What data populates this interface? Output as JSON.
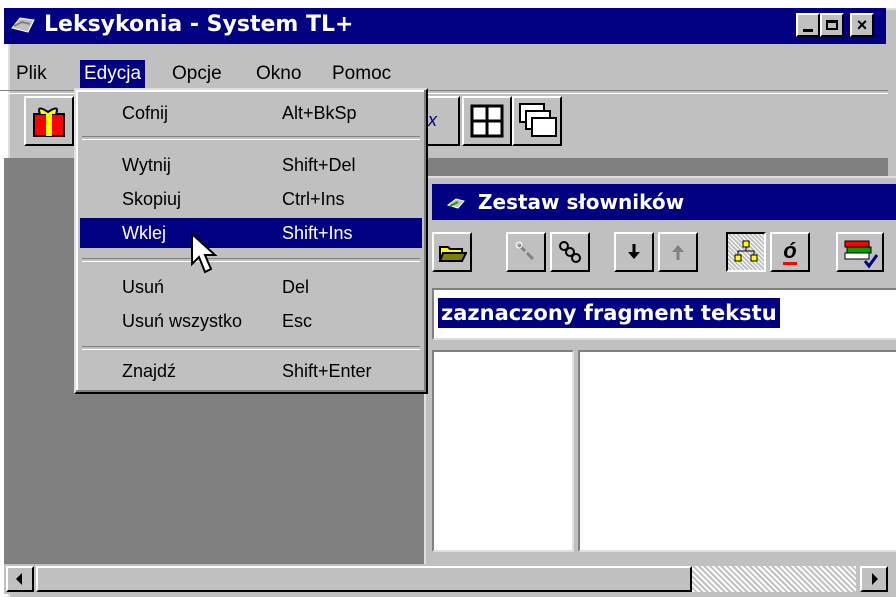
{
  "window": {
    "title": "Leksykonia - System TL+",
    "controls": {
      "minimize": "_",
      "maximize": "□",
      "close": "×"
    }
  },
  "menubar": [
    {
      "id": "plik",
      "label": "Plik"
    },
    {
      "id": "edycja",
      "label": "Edycja"
    },
    {
      "id": "opcje",
      "label": "Opcje"
    },
    {
      "id": "okno",
      "label": "Okno"
    },
    {
      "id": "pomoc",
      "label": "Pomoc"
    }
  ],
  "edit_menu": {
    "items": [
      {
        "label": "Cofnij",
        "shortcut": "Alt+BkSp"
      },
      {
        "label": "Wytnij",
        "shortcut": "Shift+Del"
      },
      {
        "label": "Skopiuj",
        "shortcut": "Ctrl+Ins"
      },
      {
        "label": "Wklej",
        "shortcut": "Shift+Ins"
      },
      {
        "label": "Usuń",
        "shortcut": "Del"
      },
      {
        "label": "Usuń wszystko",
        "shortcut": "Esc"
      },
      {
        "label": "Znajdź",
        "shortcut": "Shift+Enter"
      }
    ]
  },
  "child_window": {
    "title": "Zestaw słowników",
    "search_text": "zaznaczony fragment tekstu",
    "toolbar_icons": [
      "open-folder-icon",
      "link-icon",
      "chain-icon",
      "arrow-down-icon",
      "arrow-up-icon",
      "tree-icon",
      "accent-o-icon",
      "book-check-icon"
    ],
    "accent_char": "ó"
  },
  "colors": {
    "titlebar": "#000080",
    "face": "#c0c0c0",
    "workspace": "#808080"
  }
}
